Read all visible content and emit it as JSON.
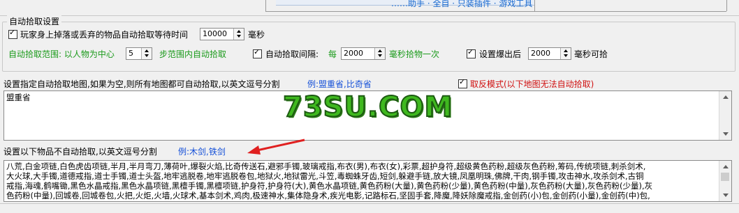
{
  "top": {
    "partial_text": "……助手 · 全自 · 只装插件 · 游戏工具"
  },
  "auto_pickup": {
    "group_title": "自动拾取设置",
    "wait_label": "玩家身上掉落或丢弃的物品自动拾取等待时间",
    "wait_value": "10000",
    "wait_unit": "毫秒",
    "range_label": "自动拾取范围: 以人物为中心",
    "range_value": "5",
    "range_unit": "步范围内自动拾取",
    "interval_label": "自动拾取间隔:",
    "interval_prefix": "每",
    "interval_value": "2000",
    "interval_unit": "毫秒拾物一次",
    "drop_label": "设置爆出后",
    "drop_value": "2000",
    "drop_unit": "毫秒可拾"
  },
  "maps": {
    "label": "设置指定自动拾取地图,如果为空,则所有地图都可自动拾取,以英文逗号分割",
    "example": "例:盟重省,比奇省",
    "reverse_label": "取反模式(以下地图无法自动拾取)",
    "value": "盟重省"
  },
  "exclude": {
    "label": "设置以下物品不自动拾取,以英文逗号分割",
    "example": "例:木剑,铁剑",
    "lines": [
      "八荒,白金项链,白色虎齿项链,半月,半月弯刀,薄荷叶,爆裂火焰,比奇传送石,避邪手镯,玻璃戒指,布衣(男),布衣(女),彩票,超护身符,超级黄色药粉,超级灰色药粉,筹码,传统项链,刺杀剑术,",
      "大火球,大手镯,道德戒指,道士手镯,道士头盔,地牢逃脱卷,地牢逃脱卷包,地狱火,地狱雷光,斗笠,毒蜘蛛牙齿,短剑,躲避手链,放大镜,凤凰明珠,佛牌,干肉,钢手镯,攻击神水,攻杀剑术,古铜",
      "戒指,海魂,鹤嘴锄,黑色水晶戒指,黑色水晶项链,黑檀手镯,黑檀项链,护身符,护身符(大),黄色水晶项链,黄色药粉(大量),黄色药粉(少量),黄色药粉(中量),灰色药粉(大量),灰色药粉(少量),灰",
      "色药粉(中量),回城卷,回城卷包,火把,火炬,火墙,火球术,基本剑术,鸡肉,极速神水,集体隐身术,疾光电影,记路标石,坚固手套,降魔,降妖除魔戒指,金创药(小)包,金创药(小量),金创药(中)包,"
    ]
  },
  "watermark": "73SU.COM"
}
